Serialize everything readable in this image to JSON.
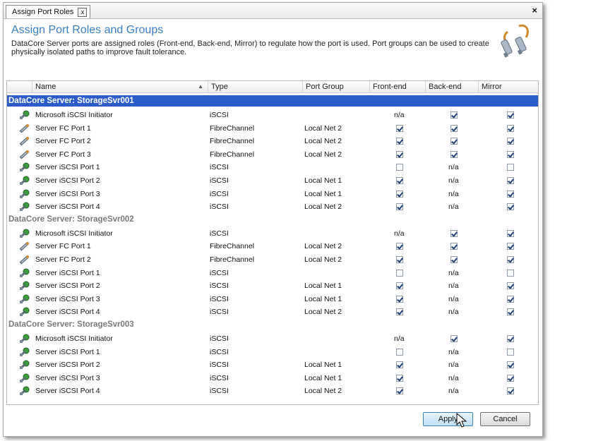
{
  "window": {
    "tab_label": "Assign Port Roles",
    "tab_close_glyph": "x",
    "close_glyph": "×"
  },
  "header": {
    "title": "Assign Port Roles and Groups",
    "description": "DataCore Server ports are assigned roles (Front-end, Back-end, Mirror) to regulate how the port is used.  Port groups can be used to create physically isolated paths to improve fault tolerance."
  },
  "grid": {
    "columns": [
      "Name",
      "Type",
      "Port Group",
      "Front-end",
      "Back-end",
      "Mirror"
    ],
    "sort_indicator": "▲",
    "groups": [
      {
        "title": "DataCore Server: StorageSvr001",
        "rows": [
          {
            "name": "Microsoft iSCSI Initiator",
            "icon": "iscsi-port-icon",
            "type": "iSCSI",
            "group": "",
            "front": "n/a",
            "back": "on",
            "mirror": "on"
          },
          {
            "name": "Server FC Port 1",
            "icon": "fc-port-icon",
            "type": "FibreChannel",
            "group": "Local Net 2",
            "front": "on",
            "back": "on",
            "mirror": "on"
          },
          {
            "name": "Server FC Port 2",
            "icon": "fc-port-icon",
            "type": "FibreChannel",
            "group": "Local Net 2",
            "front": "on",
            "back": "on",
            "mirror": "on"
          },
          {
            "name": "Server FC Port 3",
            "icon": "fc-port-icon",
            "type": "FibreChannel",
            "group": "Local Net 2",
            "front": "on",
            "back": "on",
            "mirror": "on"
          },
          {
            "name": "Server iSCSI Port 1",
            "icon": "iscsi-port-icon",
            "type": "iSCSI",
            "group": "",
            "front": "off",
            "back": "n/a",
            "mirror": "off"
          },
          {
            "name": "Server iSCSI Port 2",
            "icon": "iscsi-port-icon",
            "type": "iSCSI",
            "group": "Local Net 1",
            "front": "on",
            "back": "n/a",
            "mirror": "on"
          },
          {
            "name": "Server iSCSI Port 3",
            "icon": "iscsi-port-icon",
            "type": "iSCSI",
            "group": "Local Net 1",
            "front": "on",
            "back": "n/a",
            "mirror": "on"
          },
          {
            "name": "Server iSCSI Port 4",
            "icon": "iscsi-port-icon",
            "type": "iSCSI",
            "group": "Local Net 2",
            "front": "on",
            "back": "n/a",
            "mirror": "on"
          }
        ]
      },
      {
        "title": "DataCore Server: StorageSvr002",
        "rows": [
          {
            "name": "Microsoft iSCSI Initiator",
            "icon": "iscsi-port-icon",
            "type": "iSCSI",
            "group": "",
            "front": "n/a",
            "back": "on",
            "mirror": "on"
          },
          {
            "name": "Server FC Port 1",
            "icon": "fc-port-icon",
            "type": "FibreChannel",
            "group": "Local Net 2",
            "front": "on",
            "back": "on",
            "mirror": "on"
          },
          {
            "name": "Server FC Port 2",
            "icon": "fc-port-icon",
            "type": "FibreChannel",
            "group": "Local Net 2",
            "front": "on",
            "back": "on",
            "mirror": "on"
          },
          {
            "name": "Server iSCSI Port 1",
            "icon": "iscsi-port-icon",
            "type": "iSCSI",
            "group": "",
            "front": "off",
            "back": "n/a",
            "mirror": "off"
          },
          {
            "name": "Server iSCSI Port 2",
            "icon": "iscsi-port-icon",
            "type": "iSCSI",
            "group": "Local Net 1",
            "front": "on",
            "back": "n/a",
            "mirror": "on"
          },
          {
            "name": "Server iSCSI Port 3",
            "icon": "iscsi-port-icon",
            "type": "iSCSI",
            "group": "Local Net 1",
            "front": "on",
            "back": "n/a",
            "mirror": "on"
          },
          {
            "name": "Server iSCSI Port 4",
            "icon": "iscsi-port-icon",
            "type": "iSCSI",
            "group": "Local Net 2",
            "front": "on",
            "back": "n/a",
            "mirror": "on"
          }
        ]
      },
      {
        "title": "DataCore Server: StorageSvr003",
        "rows": [
          {
            "name": "Microsoft iSCSI Initiator",
            "icon": "iscsi-port-icon",
            "type": "iSCSI",
            "group": "",
            "front": "n/a",
            "back": "on",
            "mirror": "on"
          },
          {
            "name": "Server iSCSI Port 1",
            "icon": "iscsi-port-icon",
            "type": "iSCSI",
            "group": "",
            "front": "off",
            "back": "n/a",
            "mirror": "off"
          },
          {
            "name": "Server iSCSI Port 2",
            "icon": "iscsi-port-icon",
            "type": "iSCSI",
            "group": "Local Net 1",
            "front": "on",
            "back": "n/a",
            "mirror": "on"
          },
          {
            "name": "Server iSCSI Port 3",
            "icon": "iscsi-port-icon",
            "type": "iSCSI",
            "group": "Local Net 1",
            "front": "on",
            "back": "n/a",
            "mirror": "on"
          },
          {
            "name": "Server iSCSI Port 4",
            "icon": "iscsi-port-icon",
            "type": "iSCSI",
            "group": "Local Net 2",
            "front": "on",
            "back": "n/a",
            "mirror": "on"
          }
        ]
      }
    ]
  },
  "buttons": {
    "apply": "Apply",
    "cancel": "Cancel"
  },
  "colors": {
    "title_blue": "#3a7fc0",
    "selected_group": "#2c5cc7"
  }
}
